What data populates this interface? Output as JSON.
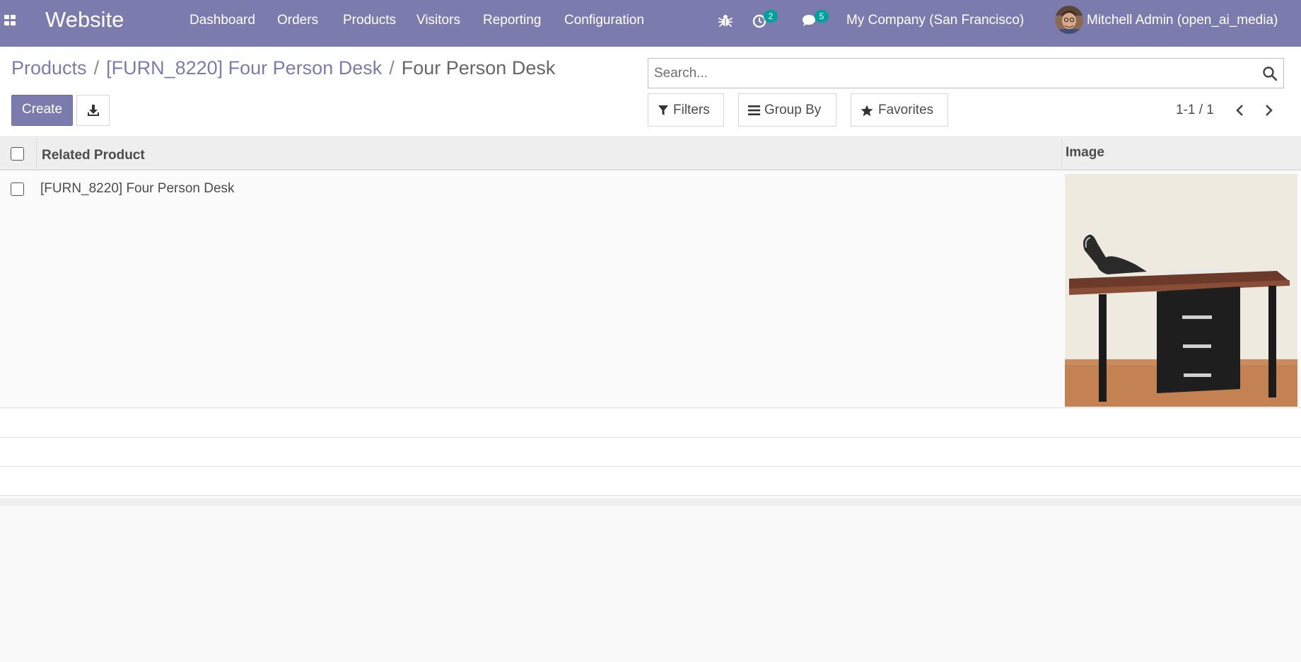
{
  "navbar": {
    "brand": "Website",
    "menu": [
      "Dashboard",
      "Orders",
      "Products",
      "Visitors",
      "Reporting",
      "Configuration"
    ],
    "activities_count": "2",
    "messages_count": "5",
    "company": "My Company (San Francisco)",
    "user": "Mitchell Admin (open_ai_media)",
    "icons": [
      "apps-grid-icon",
      "bug-icon",
      "clock-icon",
      "chat-icon"
    ]
  },
  "breadcrumb": {
    "items": [
      "Products",
      "[FURN_8220] Four Person Desk"
    ],
    "separator": "/",
    "current": "Four Person Desk"
  },
  "search": {
    "placeholder": "Search...",
    "value": ""
  },
  "buttons": {
    "create": "Create",
    "filters": "Filters",
    "group_by": "Group By",
    "favorites": "Favorites"
  },
  "pager": {
    "value": "1-1 / 1"
  },
  "table": {
    "columns": [
      "Related Product",
      "Image"
    ],
    "rows": [
      {
        "related_product": "[FURN_8220] Four Person Desk",
        "image": "desk-photo"
      }
    ]
  },
  "colors": {
    "brand": "#7c7bad",
    "badge": "#00a09d",
    "text": "#4c4c4c"
  }
}
